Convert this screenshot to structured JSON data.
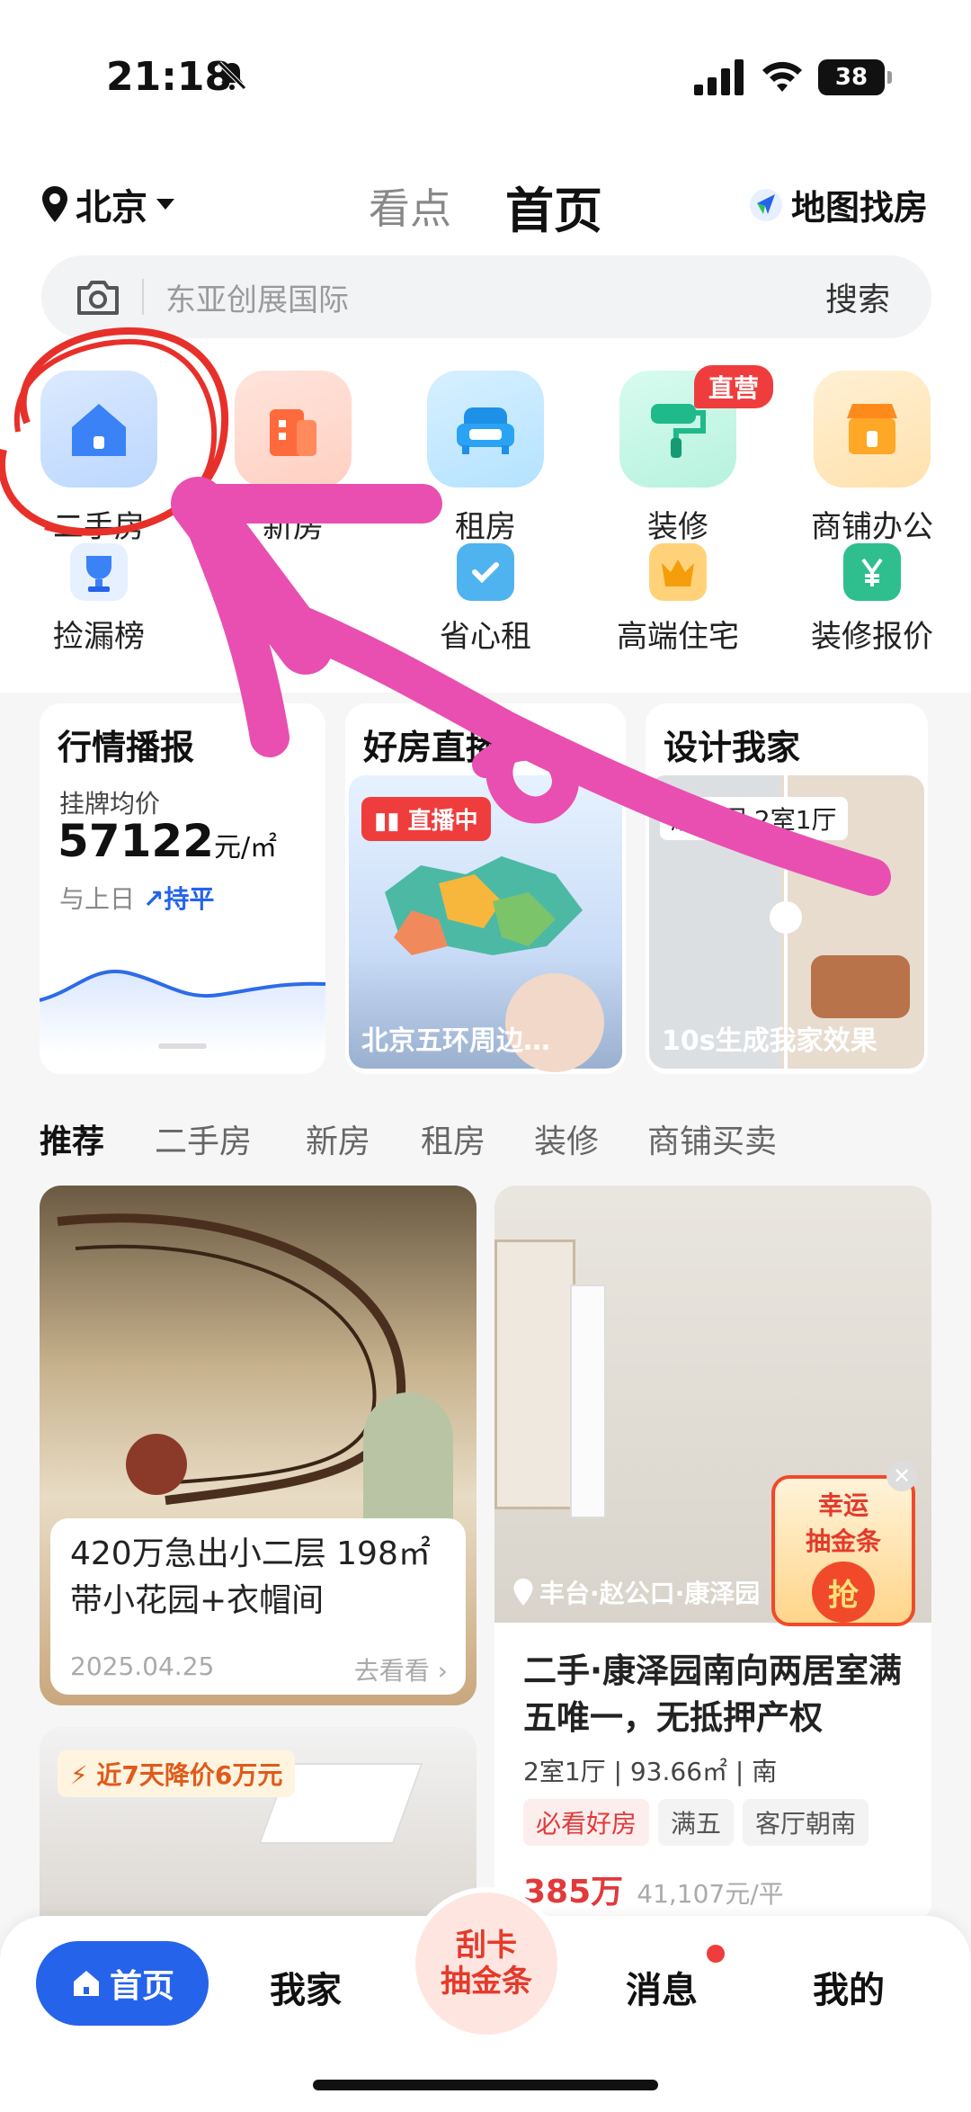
{
  "status": {
    "time": "21:18",
    "battery": "38"
  },
  "header": {
    "city": "北京",
    "tab_kandian": "看点",
    "tab_home": "首页",
    "map_search": "地图找房"
  },
  "search": {
    "placeholder": "东亚创展国际",
    "button": "搜索"
  },
  "quick_row1": [
    {
      "label": "二手房",
      "icon": "house-icon"
    },
    {
      "label": "新房",
      "icon": "building-icon"
    },
    {
      "label": "租房",
      "icon": "sofa-icon"
    },
    {
      "label": "装修",
      "icon": "paint-roller-icon",
      "badge": "直营"
    },
    {
      "label": "商铺办公",
      "icon": "shop-icon"
    }
  ],
  "quick_row2": [
    {
      "label": "捡漏榜",
      "icon": "trophy-icon"
    },
    {
      "label": "",
      "icon": "hidden"
    },
    {
      "label": "省心租",
      "icon": "heart-check-icon"
    },
    {
      "label": "高端住宅",
      "icon": "crown-icon"
    },
    {
      "label": "装修报价",
      "icon": "yen-icon"
    }
  ],
  "market_card": {
    "title": "行情播报",
    "label": "挂牌均价",
    "price": "57122",
    "unit": "元/㎡",
    "compare_label": "与上日",
    "trend": "持平"
  },
  "live_card": {
    "title": "好房直播",
    "tag": "直播中",
    "caption": "北京五环周边…"
  },
  "design_card": {
    "title": "设计我家",
    "tag": "康泽园 2室1厅",
    "caption": "10s生成我家效果"
  },
  "feed_tabs": [
    "推荐",
    "二手房",
    "新房",
    "租房",
    "装修",
    "商铺买卖"
  ],
  "listing1": {
    "title": "420万急出小二层 198㎡带小花园+衣帽间",
    "date": "2025.04.25",
    "link": "去看看"
  },
  "listing2": {
    "location": "丰台·赵公口·康泽园",
    "title": "二手·康泽园南向两居室满五唯一，无抵押产权",
    "specs": "2室1厅 | 93.66㎡ | 南",
    "tags": [
      "必看好房",
      "满五",
      "客厅朝南"
    ],
    "price": "385万",
    "unit_price": "41,107元/平"
  },
  "listing3": {
    "tag": "近7天降价6万元"
  },
  "promo": {
    "line1": "幸运",
    "line2": "抽金条",
    "btn": "抢"
  },
  "nav": {
    "home": "首页",
    "myhome": "我家",
    "center_line1": "刮卡",
    "center_line2": "抽金条",
    "messages": "消息",
    "mine": "我的"
  },
  "colors": {
    "accent": "#2563eb",
    "red": "#ef3d3d",
    "annotation_pink": "#e94fb0",
    "annotation_red": "#e8302a"
  }
}
